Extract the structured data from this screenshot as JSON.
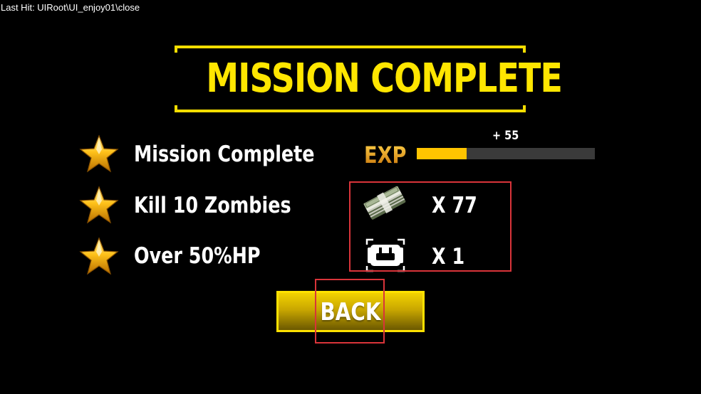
{
  "debug": {
    "last_hit": "Last Hit: UIRoot\\UI_enjoy01\\close"
  },
  "title": "MISSION COMPLETE",
  "objectives": [
    {
      "label": "Mission Complete",
      "icon": "star-icon"
    },
    {
      "label": "Kill 10 Zombies",
      "icon": "star-icon"
    },
    {
      "label": "Over 50%HP",
      "icon": "star-icon"
    }
  ],
  "exp": {
    "label": "EXP",
    "gain": "+ 55",
    "progress": 0.28
  },
  "rewards": [
    {
      "icon": "cash-stack-icon",
      "quantity": "X 77"
    },
    {
      "icon": "ammo-box-icon",
      "quantity": "X 1"
    }
  ],
  "back_button": {
    "label": "BACK"
  },
  "colors": {
    "accent": "#ffe600",
    "exp_fill": "#ffc400",
    "exp_track": "#3a3a3a",
    "highlight": "#d9343a",
    "background": "#000000"
  }
}
